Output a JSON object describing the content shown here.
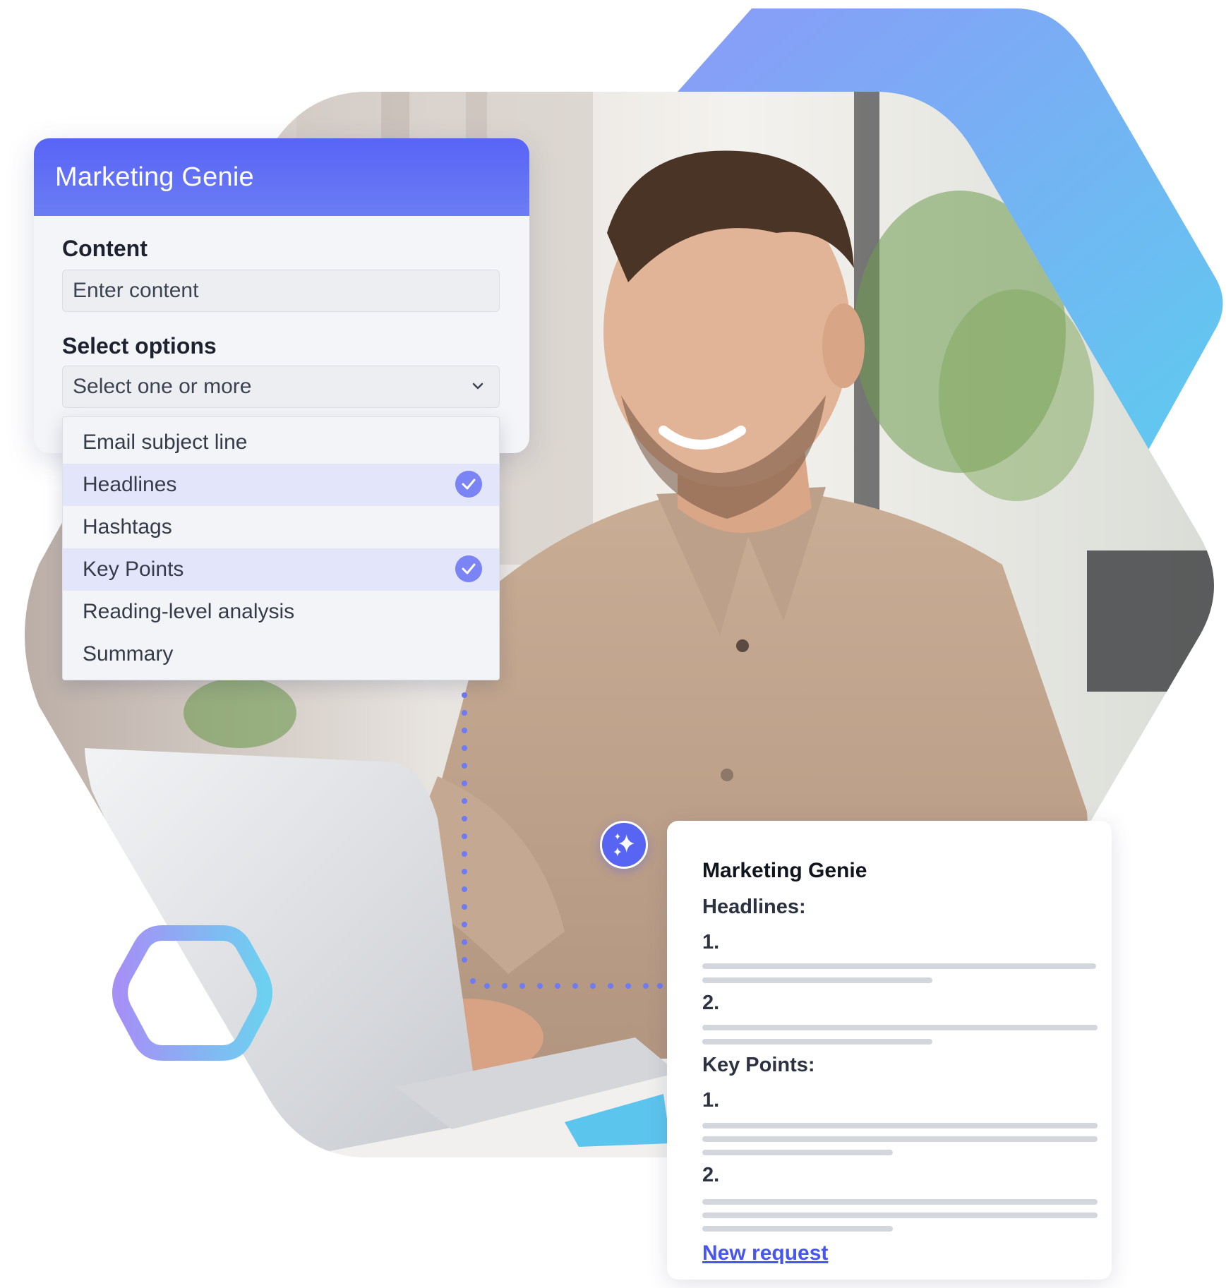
{
  "form": {
    "title": "Marketing Genie",
    "content_label": "Content",
    "content_placeholder": "Enter content",
    "options_label": "Select options",
    "options_placeholder": "Select one or more"
  },
  "dropdown": {
    "options": [
      {
        "label": "Email subject line",
        "selected": false
      },
      {
        "label": "Headlines",
        "selected": true
      },
      {
        "label": "Hashtags",
        "selected": false
      },
      {
        "label": "Key Points",
        "selected": true
      },
      {
        "label": "Reading-level analysis",
        "selected": false
      },
      {
        "label": "Summary",
        "selected": false
      }
    ]
  },
  "result": {
    "title": "Marketing Genie",
    "headlines_heading": "Headlines:",
    "headlines": [
      "1.",
      "2."
    ],
    "keypoints_heading": "Key Points:",
    "keypoints": [
      "1.",
      "2."
    ],
    "new_request_link": "New request"
  },
  "colors": {
    "accent": "#5864f6",
    "check": "#7b84f4",
    "link": "#4856f0",
    "hex_gradient_start": "#a08cf8",
    "hex_gradient_end": "#66cdef"
  },
  "icons": {
    "dropdown": "chevron-down-icon",
    "selected": "check-circle-icon",
    "badge": "sparkle-icon"
  }
}
